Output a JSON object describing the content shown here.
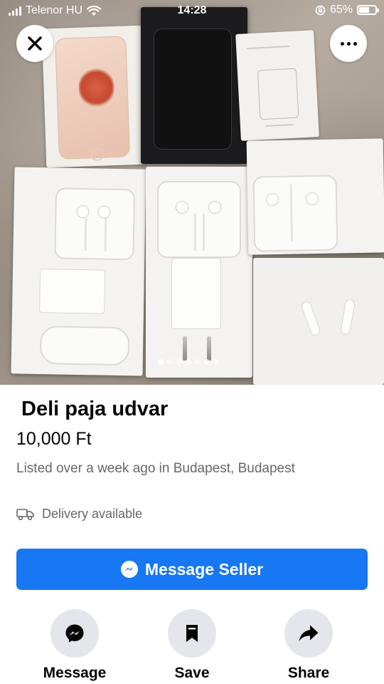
{
  "status_bar": {
    "carrier": "Telenor HU",
    "time": "14:28",
    "battery": "65%",
    "battery_level": 0.65
  },
  "gallery": {
    "image_count": 7,
    "active_index": 0
  },
  "listing": {
    "title": "Deli paja udvar",
    "price": "10,000 Ft",
    "listed": "Listed over a week ago in Budapest, Budapest",
    "delivery": "Delivery available"
  },
  "buttons": {
    "message_seller": "Message Seller"
  },
  "actions": [
    {
      "label": "Message",
      "icon": "messenger-icon"
    },
    {
      "label": "Save",
      "icon": "bookmark-icon"
    },
    {
      "label": "Share",
      "icon": "share-arrow-icon"
    }
  ],
  "colors": {
    "primary": "#1877f2",
    "secondary_text": "#65676b",
    "action_circle": "#e4e6eb"
  }
}
